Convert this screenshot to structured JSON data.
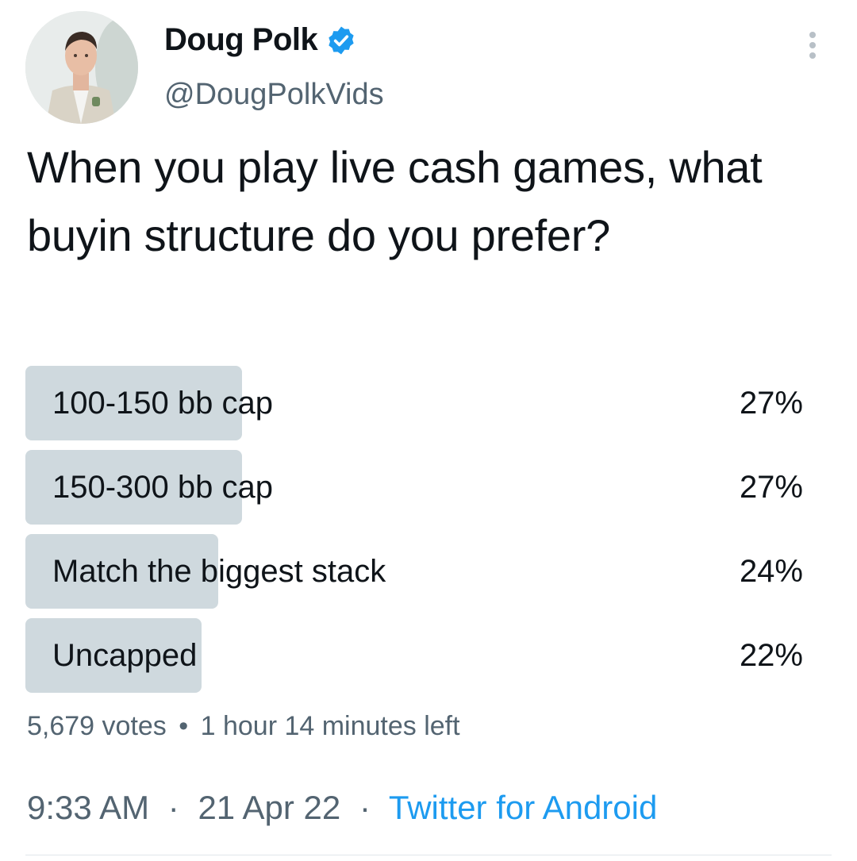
{
  "author": {
    "name": "Doug Polk",
    "handle": "@DougPolkVids",
    "verified": true,
    "avatar_icon": "profile-photo",
    "verified_icon": "verified-badge-icon",
    "more_icon": "more-vertical-icon"
  },
  "tweet": {
    "text": "When you play live cash games, what buyin structure do you prefer?"
  },
  "poll": {
    "options": [
      {
        "label": "100-150 bb cap",
        "percent_text": "27%",
        "percent": 27
      },
      {
        "label": "150-300 bb cap",
        "percent_text": "27%",
        "percent": 27
      },
      {
        "label": "Match the biggest stack",
        "percent_text": "24%",
        "percent": 24
      },
      {
        "label": "Uncapped",
        "percent_text": "22%",
        "percent": 22
      }
    ],
    "votes": "5,679 votes",
    "separator": "•",
    "time_left": "1 hour 14 minutes left"
  },
  "meta": {
    "time": "9:33 AM",
    "date": "21 Apr 22",
    "dot": "·",
    "source": "Twitter for Android"
  },
  "colors": {
    "accent": "#1d9bf0",
    "bar": "#cfd9de",
    "secondary_text": "#536471"
  }
}
